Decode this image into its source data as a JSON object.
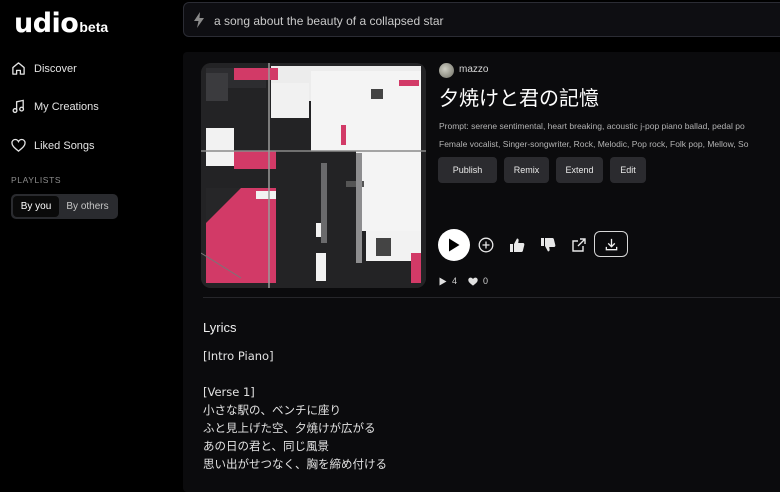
{
  "app": {
    "logo": "udio",
    "badge": "beta"
  },
  "search": {
    "value": "a song about the beauty of a collapsed star"
  },
  "sidebar": {
    "items": [
      {
        "label": "Discover",
        "icon": "home-icon"
      },
      {
        "label": "My Creations",
        "icon": "music-note-icon"
      },
      {
        "label": "Liked Songs",
        "icon": "heart-icon"
      }
    ],
    "playlists_label": "PLAYLISTS",
    "toggle": {
      "left": "By you",
      "right": "By others",
      "selected": "By you"
    }
  },
  "song": {
    "username": "mazzo",
    "title": "夕焼けと君の記憶",
    "prompt": "Prompt: serene sentimental, heart breaking, acoustic j-pop piano ballad, pedal po",
    "tags": "Female vocalist, Singer-songwriter, Rock, Melodic, Pop rock, Folk pop, Mellow, So",
    "actions": [
      "Publish",
      "Remix",
      "Extend",
      "Edit"
    ],
    "plays": "4",
    "likes": "0"
  },
  "lyrics": {
    "heading": "Lyrics",
    "text": "[Intro Piano]\n\n[Verse 1]\n小さな駅の、ベンチに座り\nふと見上げた空、夕焼けが広がる\nあの日の君と、同じ風景\n思い出がせつなく、胸を締め付ける"
  },
  "colors": {
    "accent_pink": "#d23a67",
    "background": "#000000",
    "panel": "#0b0b0d"
  }
}
